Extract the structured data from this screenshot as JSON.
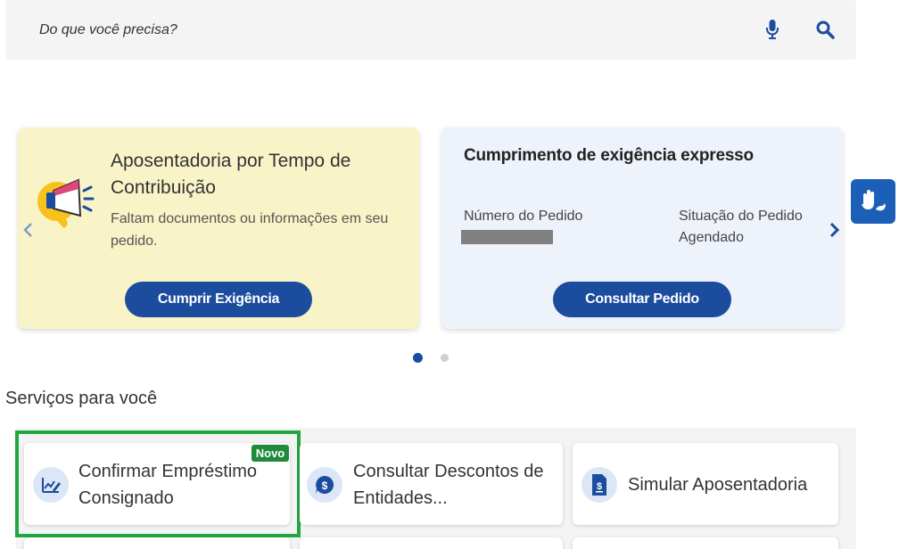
{
  "search": {
    "placeholder": "Do que você precisa?",
    "mic_icon": "microphone-icon",
    "search_icon": "search-icon"
  },
  "carousel": {
    "cards": [
      {
        "title": "Aposentadoria por Tempo de Contribuição",
        "description": "Faltam documentos ou informações em seu pedido.",
        "button_label": "Cumprir Exigência",
        "icon": "megaphone-icon",
        "background": "#f9f4c8"
      },
      {
        "title": "Cumprimento de exigência expresso",
        "field1_label": "Número do Pedido",
        "field2_label": "Situação do Pedido",
        "field2_value": "Agendado",
        "button_label": "Consultar Pedido",
        "background": "#eef3fb"
      }
    ],
    "active_page": 1,
    "page_count": 2
  },
  "accessibility": {
    "icon": "libras-hands-icon"
  },
  "services": {
    "title": "Serviços para você",
    "items": [
      {
        "label": "Confirmar Empréstimo Consignado",
        "icon": "chart-pen-icon",
        "badge": "Novo",
        "highlighted": true
      },
      {
        "label": "Consultar Descontos de Entidades...",
        "icon": "dollar-chat-icon"
      },
      {
        "label": "Simular Aposentadoria",
        "icon": "document-dollar-icon"
      }
    ]
  },
  "colors": {
    "primary": "#1c4c9e",
    "accent_blue": "#1c5fb8",
    "highlight_green": "#22a640",
    "badge_green": "#1e8a3a"
  }
}
